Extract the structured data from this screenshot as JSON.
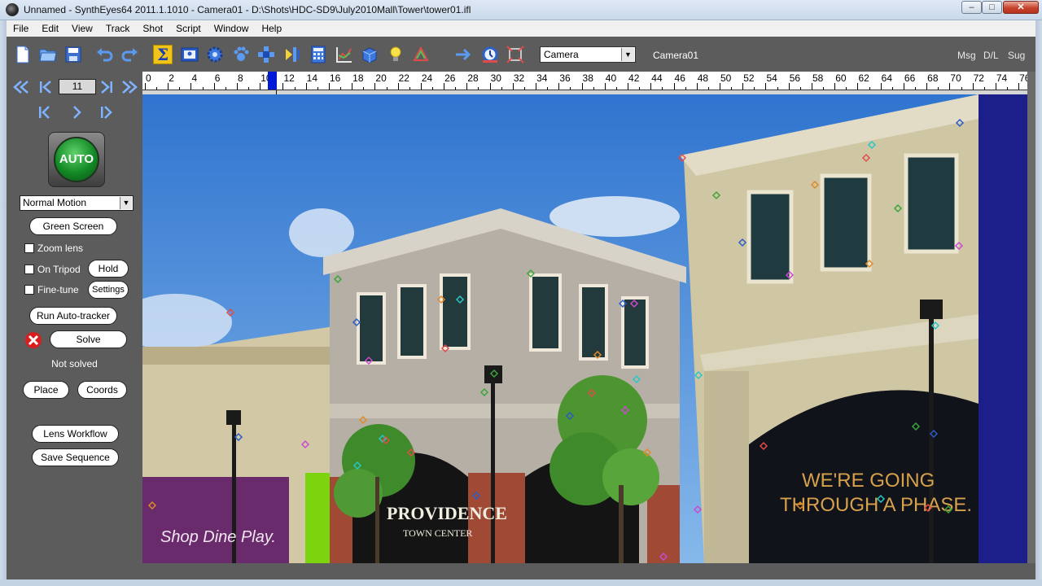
{
  "window": {
    "title": "Unnamed - SynthEyes64 2011.1.1010 - Camera01 - D:\\Shots\\HDC-SD9\\July2010Mall\\Tower\\tower01.ifl",
    "controls": {
      "minimize": "–",
      "maximize": "□",
      "close": "✕"
    }
  },
  "menu": [
    "File",
    "Edit",
    "View",
    "Track",
    "Shot",
    "Script",
    "Window",
    "Help"
  ],
  "toolbar": {
    "icons": [
      "new-file-icon",
      "open-folder-icon",
      "save-icon",
      "undo-icon",
      "redo-icon",
      "sigma-icon",
      "camera-view-icon",
      "gear-icon",
      "paw-icon",
      "crosshair-icon",
      "lens-icon",
      "calculator-icon",
      "graph-icon",
      "cube-icon",
      "lightbulb-icon",
      "triangle-icon",
      "arrow-right-icon",
      "clock-icon",
      "frame-icon"
    ],
    "camera_select": "Camera",
    "camera_label": "Camera01",
    "right_labels": [
      "Msg",
      "D/L",
      "Sug"
    ]
  },
  "panel": {
    "frame_number": "11",
    "auto_label": "AUTO",
    "motion_select": "Normal Motion",
    "green_screen": "Green Screen",
    "zoom_lens": "Zoom lens",
    "on_tripod": "On Tripod",
    "hold": "Hold",
    "fine_tune": "Fine-tune",
    "settings": "Settings",
    "run_autotracker": "Run Auto-tracker",
    "solve": "Solve",
    "solve_status": "Not solved",
    "place": "Place",
    "coords": "Coords",
    "lens_workflow": "Lens Workflow",
    "save_sequence": "Save Sequence"
  },
  "timeline": {
    "labels": [
      "0",
      "2",
      "4",
      "6",
      "8",
      "10",
      "12",
      "14",
      "16",
      "18",
      "20",
      "22",
      "24",
      "26",
      "28",
      "30",
      "32",
      "34",
      "36",
      "38",
      "40",
      "42",
      "44",
      "46",
      "48",
      "50",
      "52",
      "54",
      "56",
      "58",
      "60",
      "62",
      "64",
      "66",
      "68",
      "70",
      "72",
      "74",
      "76"
    ],
    "current_frame": 11
  },
  "scene": {
    "sign_providence": "PROVIDENCE",
    "sign_town_center": "TOWN CENTER",
    "sign_phase_1": "WE'RE GOING",
    "sign_phase_2": "THROUGH A PHASE.",
    "sign_shop": "Shop Dine Play."
  },
  "colors": {
    "accent": "#0019d6",
    "toolbar_bg": "#5c5c5c",
    "sky": "#3f86d8",
    "auto_green": "#138a25"
  }
}
